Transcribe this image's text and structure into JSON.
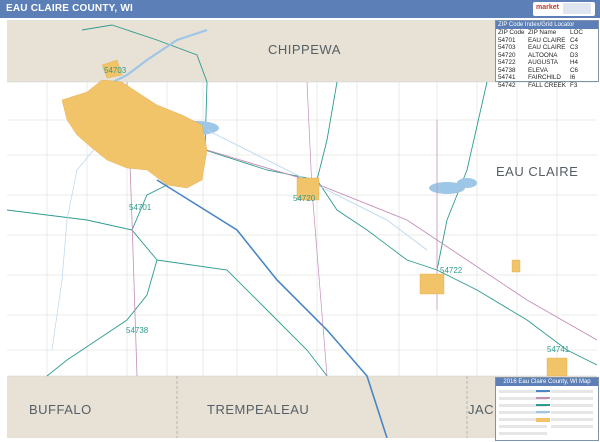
{
  "header": {
    "title": "EAU CLAIRE COUNTY, WI",
    "logo_text": "market"
  },
  "counties": {
    "chippewa": "CHIPPEWA",
    "eau_claire": "EAU CLAIRE",
    "buffalo": "BUFFALO",
    "trempealeau": "TREMPEALEAU",
    "jackson": "JAC"
  },
  "map_zip_labels": {
    "z54703": "54703",
    "z54701": "54701",
    "z54720": "54720",
    "z54722": "54722",
    "z54738": "54738",
    "z54741": "54741"
  },
  "zip_locator": {
    "title": "ZIP Code Index/Grid Locator",
    "headers": [
      "ZIP Code",
      "ZIP Name",
      "LOC"
    ],
    "rows": [
      [
        "54701",
        "EAU CLAIRE",
        "C4"
      ],
      [
        "54703",
        "EAU CLAIRE",
        "C3"
      ],
      [
        "54720",
        "ALTOONA",
        "D3"
      ],
      [
        "54722",
        "AUGUSTA",
        "H4"
      ],
      [
        "54738",
        "ELEVA",
        "C6"
      ],
      [
        "54741",
        "FAIRCHILD",
        "I6"
      ],
      [
        "54742",
        "FALL CREEK",
        "F3"
      ]
    ]
  },
  "map_key": {
    "title": "2016 Eau Claire County, WI Map"
  },
  "colors": {
    "title_bar": "#5b7fb6",
    "neighbor_fill": "#e8e1d5",
    "city_fill": "#f2c46a",
    "water": "#9ec6e6",
    "zip_boundary": "#2e9b8f",
    "interstate": "#4a86c5",
    "highway": "#c48cb8"
  }
}
